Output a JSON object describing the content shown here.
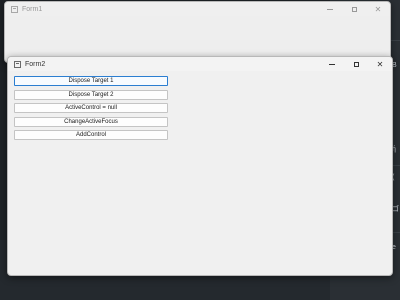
{
  "window_back": {
    "title": "Form1"
  },
  "window_front": {
    "title": "Form2",
    "buttons": [
      {
        "label": "Dispose Target 1",
        "focused": true
      },
      {
        "label": "Dispose Target 2",
        "focused": false
      },
      {
        "label": "ActiveControl = null",
        "focused": false
      },
      {
        "label": "ChangeActiveFocus",
        "focused": false
      },
      {
        "label": "AddControl",
        "focused": false
      }
    ]
  },
  "caption": {
    "minimize": "",
    "maximize": "",
    "close": "✕"
  },
  "background_app": {
    "fragments": [
      "B",
      "ή",
      "(",
      "ゴ",
      "e"
    ]
  },
  "colors": {
    "focus_border": "#2b7ed1",
    "window_bg": "#f0f0f0",
    "desktop_bg": "#1e2226"
  }
}
